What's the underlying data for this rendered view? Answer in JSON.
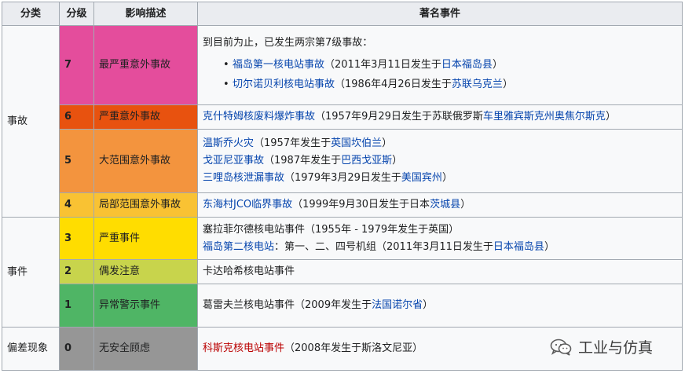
{
  "colors": {
    "level7": "#e44d9c",
    "level6": "#e8520f",
    "level5": "#f3943e",
    "level4": "#f9c233",
    "level3": "#ffdd00",
    "level2": "#c8d44c",
    "level1": "#4fb565",
    "level0": "#969696",
    "link": "#0645ad",
    "redlink": "#ba0000"
  },
  "headers": {
    "category": "分类",
    "level": "分级",
    "impact": "影响描述",
    "events": "著名事件"
  },
  "categories": {
    "accident": "事故",
    "incident": "事件",
    "deviation": "偏差现象"
  },
  "rows": {
    "r7": {
      "level": "7",
      "impact": "最严重意外事故",
      "intro": "到目前为止，已发生两宗第7级事故：",
      "items": [
        {
          "link": "福岛第一核电站事故",
          "mid": "（2011年3月11日发生于",
          "place": "日本福岛县",
          "end": "）"
        },
        {
          "link": "切尔诺贝利核电站事故",
          "mid": "（1986年4月26日发生于",
          "place": "苏联乌克兰",
          "end": "）"
        }
      ]
    },
    "r6": {
      "level": "6",
      "impact": "严重意外事故",
      "link": "克什特姆核废料爆炸事故",
      "mid": "（1957年9月29日发生于苏联俄罗斯",
      "place": "车里雅宾斯克州奥焦尔斯克",
      "end": "）"
    },
    "r5": {
      "level": "5",
      "impact": "大范围意外事故",
      "items": [
        {
          "link": "温斯乔火灾",
          "mid": "（1957年发生于",
          "place": "英国坎伯兰",
          "end": "）"
        },
        {
          "link": "戈亚尼亚事故",
          "mid": "（1987年发生于",
          "place": "巴西戈亚斯",
          "end": "）"
        },
        {
          "link": "三哩岛核泄漏事故",
          "mid": "（1979年3月29日发生于",
          "place": "美国宾州",
          "end": "）"
        }
      ]
    },
    "r4": {
      "level": "4",
      "impact": "局部范围意外事故",
      "link": "东海村JCO临界事故",
      "mid": "（1999年9月30日发生于日本",
      "place": "茨城县",
      "end": "）"
    },
    "r3": {
      "level": "3",
      "impact": "严重事件",
      "line1": "塞拉菲尔德核电站事件（1955年 - 1979年发生于英国）",
      "link2": "福岛第二核电站",
      "mid2": "：第一、二、四号机组（2011年3月11日发生于",
      "place2": "日本福岛县",
      "end2": "）"
    },
    "r2": {
      "level": "2",
      "impact": "偶发注意",
      "text": "卡达哈希核电站事件"
    },
    "r1": {
      "level": "1",
      "impact": "异常警示事件",
      "text": "葛雷夫兰核电站事件（2009年发生于",
      "place": "法国诺尔省",
      "end": "）"
    },
    "r0": {
      "level": "0",
      "impact": "无安全顾虑",
      "link": "科斯克核电站事件",
      "mid": "（2008年发生于斯洛文尼亚）"
    }
  },
  "watermark": {
    "icon": "wechat-icon",
    "text": "工业与仿真"
  }
}
